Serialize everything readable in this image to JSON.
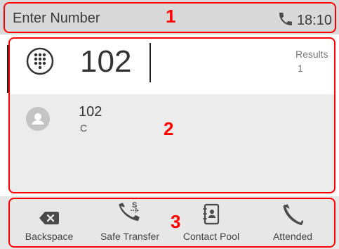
{
  "status_bar": {
    "title": "Enter Number",
    "time": "18:10",
    "icon": "phone-icon"
  },
  "entry": {
    "value": "102",
    "results_label": "Results",
    "results_count": "1",
    "icon": "keypad-icon"
  },
  "results": [
    {
      "number": "102",
      "name": "C",
      "icon": "contact-avatar-icon"
    }
  ],
  "softkeys": [
    {
      "label": "Backspace",
      "icon": "backspace-icon"
    },
    {
      "label": "Safe Transfer",
      "icon": "safe-transfer-icon"
    },
    {
      "label": "Contact Pool",
      "icon": "contact-pool-icon"
    },
    {
      "label": "Attended",
      "icon": "phone-icon"
    }
  ],
  "callouts": [
    "1",
    "2",
    "3"
  ],
  "colors": {
    "accent": "#ff0000",
    "status_bg": "#d9d9d9",
    "softkey_bg": "#e7e7e7",
    "icon": "#4a4a4a"
  }
}
